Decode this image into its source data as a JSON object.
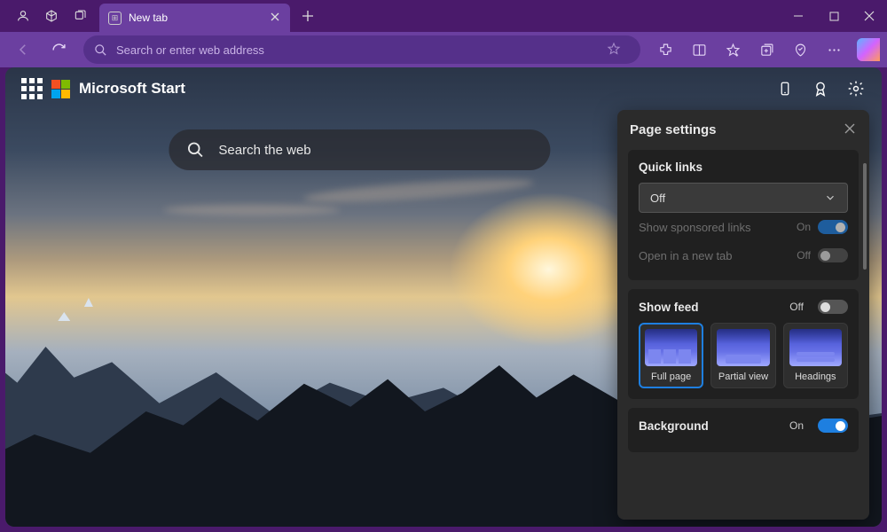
{
  "tab": {
    "title": "New tab"
  },
  "addressbar": {
    "placeholder": "Search or enter web address"
  },
  "page": {
    "brand": "Microsoft Start",
    "search_placeholder": "Search the web"
  },
  "panel": {
    "title": "Page settings",
    "sections": {
      "quicklinks": {
        "title": "Quick links",
        "dropdown_value": "Off",
        "sponsored": {
          "label": "Show sponsored links",
          "state": "On"
        },
        "newtab": {
          "label": "Open in a new tab",
          "state": "Off"
        }
      },
      "feed": {
        "title": "Show feed",
        "state": "Off",
        "options": [
          "Full page",
          "Partial view",
          "Headings"
        ]
      },
      "background": {
        "title": "Background",
        "state": "On"
      }
    }
  }
}
